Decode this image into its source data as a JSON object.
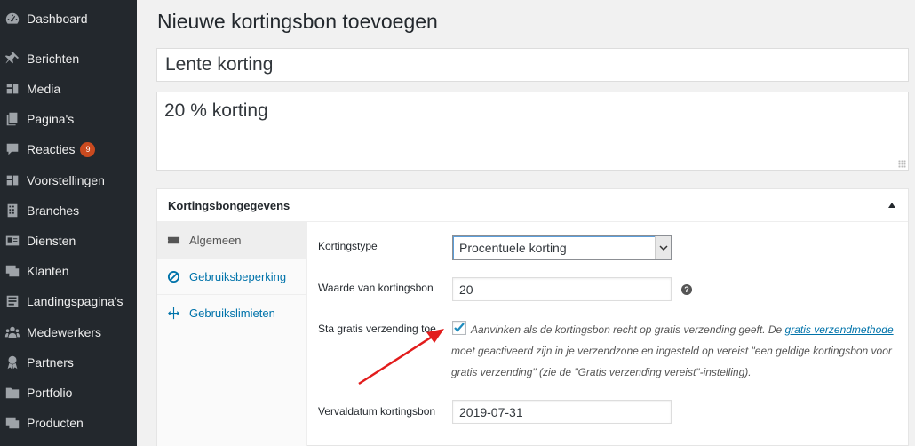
{
  "sidebar": {
    "items": [
      {
        "label": "Dashboard",
        "icon": "dashboard-icon"
      },
      {
        "label": "Berichten",
        "icon": "pin-icon"
      },
      {
        "label": "Media",
        "icon": "media-icon"
      },
      {
        "label": "Pagina's",
        "icon": "pages-icon"
      },
      {
        "label": "Reacties",
        "icon": "comment-icon",
        "badge": "9"
      },
      {
        "label": "Voorstellingen",
        "icon": "media-icon"
      },
      {
        "label": "Branches",
        "icon": "building-icon"
      },
      {
        "label": "Diensten",
        "icon": "id-card-icon"
      },
      {
        "label": "Klanten",
        "icon": "images-icon"
      },
      {
        "label": "Landingspagina's",
        "icon": "list-icon"
      },
      {
        "label": "Medewerkers",
        "icon": "groups-icon"
      },
      {
        "label": "Partners",
        "icon": "award-icon"
      },
      {
        "label": "Portfolio",
        "icon": "folder-icon"
      },
      {
        "label": "Producten",
        "icon": "images-icon"
      }
    ]
  },
  "page": {
    "title": "Nieuwe kortingsbon toevoegen",
    "coupon_code": "Lente korting",
    "description": "20 % korting"
  },
  "panel": {
    "title": "Kortingsbongegevens",
    "tabs": [
      {
        "label": "Algemeen",
        "icon": "ticket-icon"
      },
      {
        "label": "Gebruiksbeperking",
        "icon": "block-icon"
      },
      {
        "label": "Gebruikslimieten",
        "icon": "arrows-icon"
      }
    ],
    "fields": {
      "discount_type_label": "Kortingstype",
      "discount_type_value": "Procentuele korting",
      "amount_label": "Waarde van kortingsbon",
      "amount_value": "20",
      "free_shipping_label": "Sta gratis verzending toe",
      "free_shipping_checked": true,
      "free_shipping_desc_1": "Aanvinken als de kortingsbon recht op gratis verzending geeft. De ",
      "free_shipping_link": "gratis verzendmethode",
      "free_shipping_desc_2": " moet geactiveerd zijn in je verzendzone en ingesteld op vereist \"een geldige kortingsbon voor gratis verzending\" (zie de \"Gratis verzending vereist\"-instelling).",
      "expiry_label": "Vervaldatum kortingsbon",
      "expiry_value": "2019-07-31"
    }
  },
  "colors": {
    "sidebar_bg": "#23282d",
    "link": "#0073aa",
    "badge": "#ca4a1f",
    "annotation_arrow": "#e21c1c"
  }
}
